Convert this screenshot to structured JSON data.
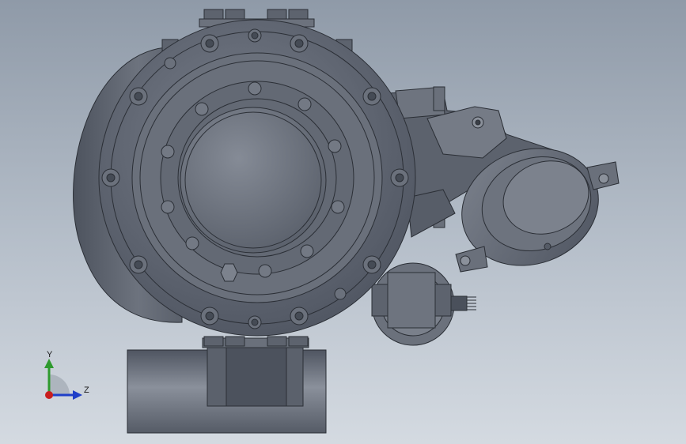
{
  "viewport": {
    "background_top": "#8f9aa8",
    "background_bottom": "#d4dae1",
    "model_color": "#6b7280"
  },
  "triad": {
    "y_label": "Y",
    "z_label": "Z",
    "y_color": "#2e9a2e",
    "z_color": "#1f3fc8",
    "x_color": "#c81e1e"
  }
}
